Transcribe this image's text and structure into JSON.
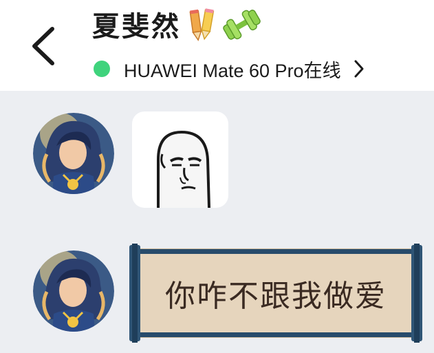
{
  "header": {
    "title": "夏斐然",
    "status_text": "HUAWEI Mate 60 Pro在线",
    "back_icon": "chevron-left-icon",
    "status_dot_color": "#3fd37c"
  },
  "messages": [
    {
      "type": "sticker",
      "sender": "contact",
      "content": "blank-face-meme-sticker"
    },
    {
      "type": "text-card",
      "sender": "contact",
      "text": "你咋不跟我做爱"
    }
  ],
  "colors": {
    "background": "#eceef2",
    "header_bg": "#ffffff",
    "scroll_bg": "#e6d5bd",
    "scroll_border": "#274b6b"
  }
}
